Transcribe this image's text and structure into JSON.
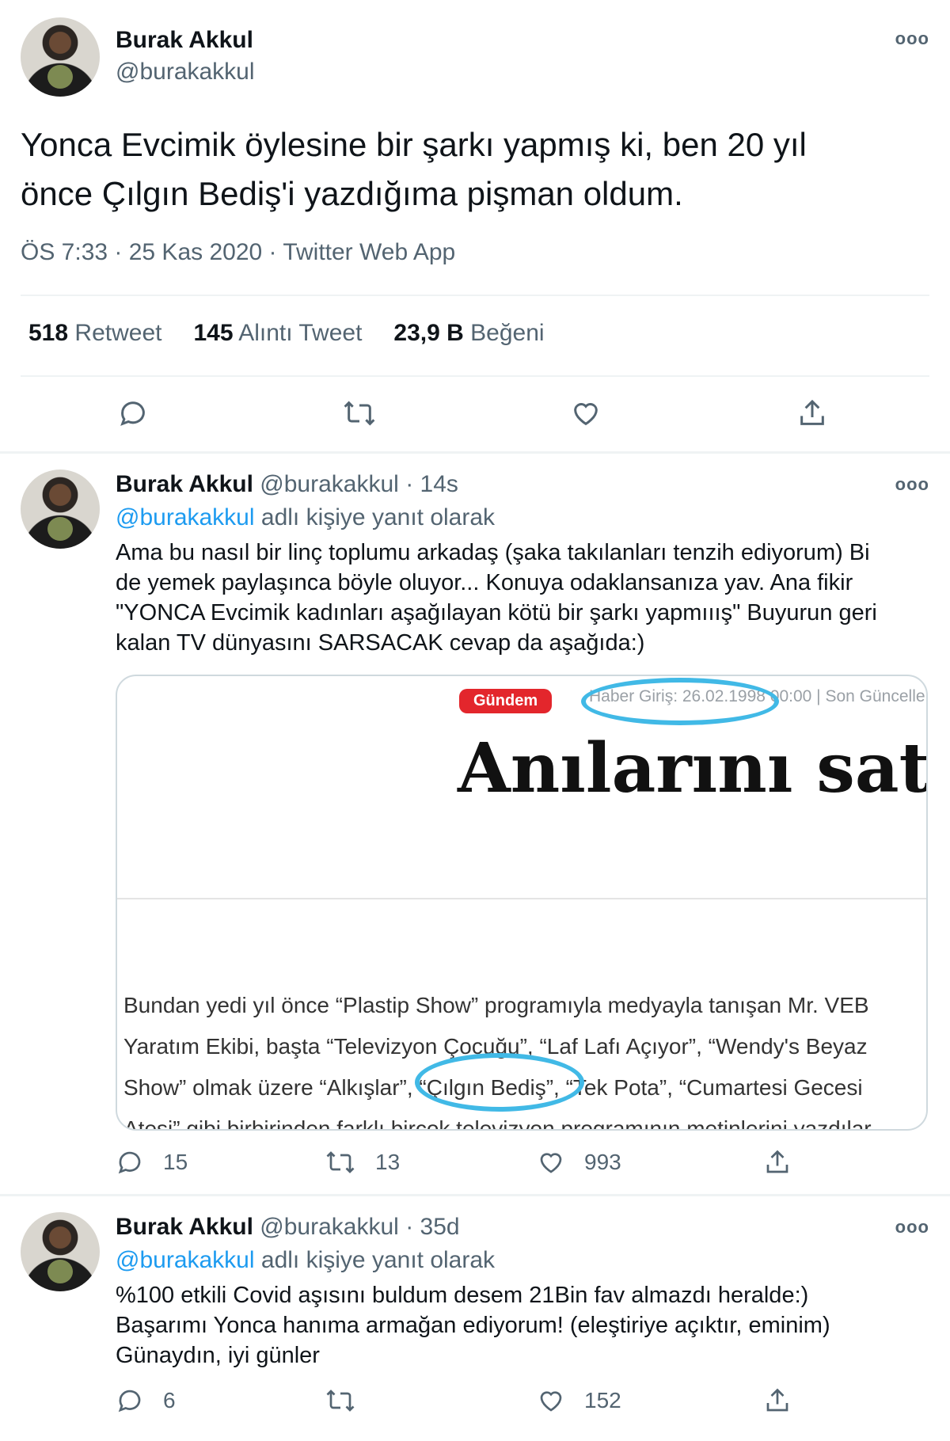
{
  "main_tweet": {
    "name": "Burak Akkul",
    "handle": "@burakakkul",
    "more": "ooo",
    "text_line1": "Yonca Evcimik öylesine bir şarkı yapmış ki, ben 20 yıl",
    "text_line2": "önce Çılgın Bediş'i yazdığıma pişman oldum.",
    "meta": "ÖS 7:33 · 25 Kas 2020 · Twitter Web App",
    "stats": {
      "retweet_count": "518",
      "retweet_label": "Retweet",
      "quote_count": "145",
      "quote_label": "Alıntı Tweet",
      "like_count": "23,9 B",
      "like_label": "Beğeni"
    },
    "icons": [
      "reply-icon",
      "retweet-icon",
      "like-icon",
      "share-icon"
    ]
  },
  "reply1": {
    "name": "Burak Akkul",
    "handle": "@burakakkul",
    "time": "· 14s",
    "more": "ooo",
    "replying_handle": "@burakakkul",
    "replying_text": "adlı kişiye yanıt olarak",
    "body_lines": [
      "Ama bu nasıl bir linç toplumu arkadaş (şaka takılanları tenzih ediyorum) Bi",
      "de yemek paylaşınca böyle oluyor... Konuya odaklansanıza yav. Ana fikir",
      "\"YONCA Evcimik kadınları aşağılayan kötü bir şarkı yapmııış\" Buyurun geri",
      "kalan TV dünyasını SARSACAK cevap da aşağıda:)"
    ],
    "card": {
      "tag": "Gündem",
      "date": "Haber Giriş: 26.02.1998 00:00 | Son Güncelle",
      "headline": "Anılarını satıy",
      "paragraph_lines": [
        "Bundan yedi yıl önce “Plastip Show” programıyla medyayla tanışan Mr. VEB",
        "Yaratım Ekibi, başta “Televizyon Çocuğu”, “Laf Lafı Açıyor”, “Wendy's Beyaz",
        "Show” olmak üzere “Alkışlar”, “Çılgın Bediş”, “Tek Pota”, “Cumartesi Gecesi",
        "Ateşi” gibi birbirinden farklı birçok televizyon programının metinlerini yazdılar."
      ]
    },
    "counts": {
      "reply": "15",
      "retweet": "13",
      "like": "993"
    }
  },
  "reply2": {
    "name": "Burak Akkul",
    "handle": "@burakakkul",
    "time": "· 35d",
    "more": "ooo",
    "replying_handle": "@burakakkul",
    "replying_text": "adlı kişiye yanıt olarak",
    "body_lines": [
      "%100 etkili Covid aşısını buldum desem 21Bin fav almazdı heralde:)",
      "Başarımı Yonca hanıma armağan ediyorum! (eleştiriye açıktır, eminim)",
      "Günaydın, iyi günler"
    ],
    "counts": {
      "reply": "6",
      "like": "152"
    }
  },
  "colors": {
    "link": "#1d9bf0",
    "secondary": "#536471",
    "highlight_ring": "#41b9e6",
    "tag_red": "#e3262c"
  }
}
